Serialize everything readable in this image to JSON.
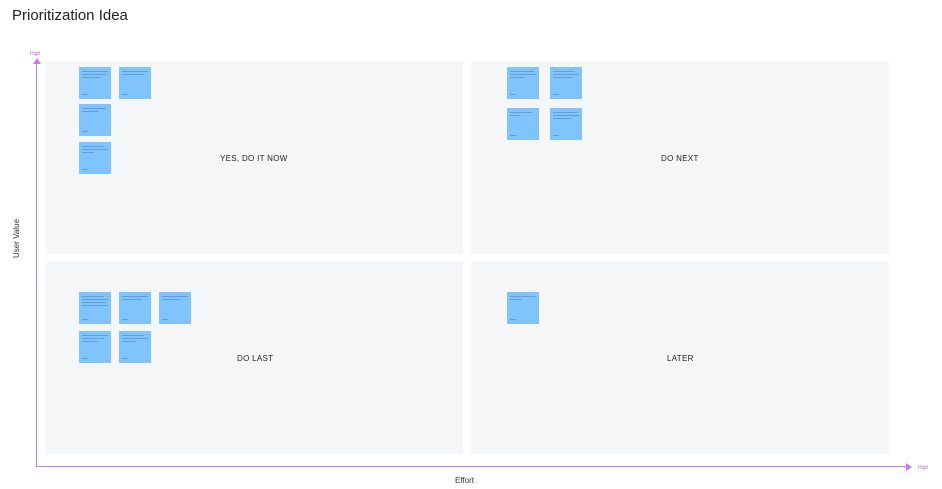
{
  "title": "Prioritization Idea",
  "y_axis": {
    "label": "User Value",
    "high_label": "High"
  },
  "x_axis": {
    "label": "Effort",
    "high_label": "High"
  },
  "quadrants": [
    {
      "label": "YES, DO IT NOW",
      "note_count": 4
    },
    {
      "label": "DO NEXT",
      "note_count": 4
    },
    {
      "label": "DO LAST",
      "note_count": 5
    },
    {
      "label": "LATER",
      "note_count": 1
    }
  ],
  "note_color": "#80c4fe",
  "axis_color": "#c77cf0",
  "quadrant_color": "#f5f6f7"
}
